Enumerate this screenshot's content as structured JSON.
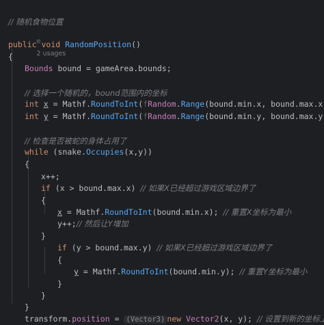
{
  "editor": {
    "background": "#1e1f22",
    "lines": {
      "comment_title": "// 随机食物位置",
      "usages": "2 usages",
      "method_kw_public": "public",
      "method_kw_void": "void",
      "method_name": "RandomPosition",
      "method_parens": "()",
      "brace_open": "{",
      "bounds_type": "Bounds",
      "bounds_decl": " bound = gameArea.bounds;",
      "comment_choose": "// 选择一个随机的，bound范围内的坐标",
      "int_kw": "int",
      "x_var": "x",
      "eq": " = ",
      "mathf": "Mathf",
      "round": "RoundToInt",
      "ghost_f": "f",
      "random": "Random",
      "range": "Range",
      "x_args": "(bound.min.x, bound.max.x));",
      "y_var": "y",
      "y_args": "(bound.min.y, bound.max.y));",
      "comment_check": "// 检查是否被蛇的身体占用了",
      "while_kw": "while",
      "while_expr_a": " (snake.",
      "occupies": "Occupies",
      "while_expr_b": "(x,y))",
      "x_inc": "x++;",
      "if_kw": "if",
      "if_x_cond": " (x > bound.max.x) ",
      "comment_x_over": "// 如果X已经超过游戏区域边界了",
      "x_assign_args": "(bound.min.x); ",
      "comment_reset_x": "// 重置X坐标为最小",
      "y_inc": "y++;",
      "comment_then_y": "// 然后让Y增加",
      "if_y_cond": " (y > bound.max.y) ",
      "comment_y_over": "// 如果X已经超过游戏区域边界了",
      "y_assign_args": "(bound.min.y); ",
      "comment_reset_y": "// 重置Y坐标为最小",
      "brace_close": "}",
      "transform": "transform.",
      "position": "position",
      "assign": " = ",
      "hint_vector3": "(Vector3)",
      "new_kw": "new",
      "vector2": "Vector2",
      "vec_args": "(x, y); ",
      "comment_set_pos": "// 设置到新的坐标上"
    }
  }
}
